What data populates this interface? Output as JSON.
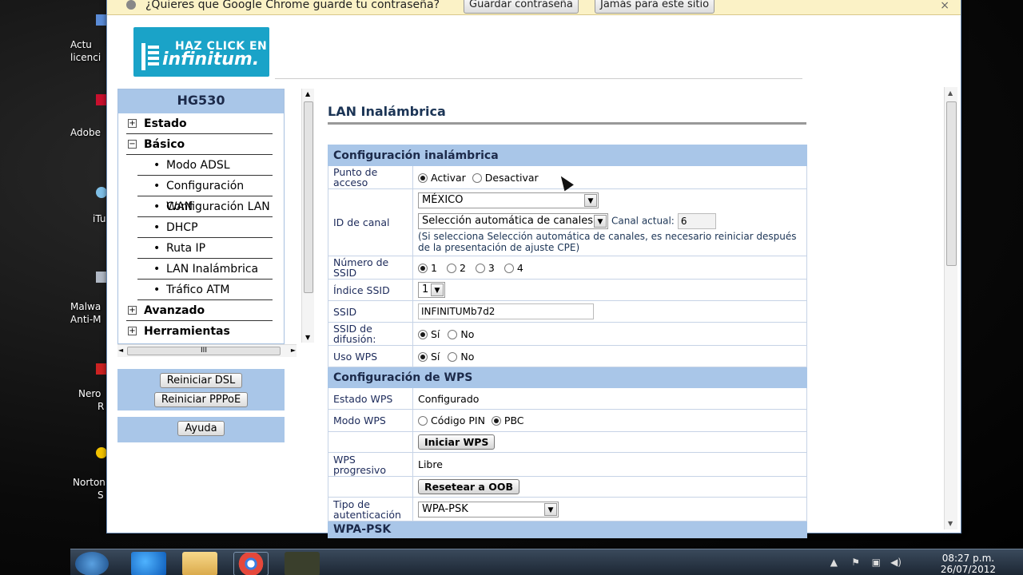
{
  "desktop": {
    "icons": [
      {
        "label_top": "Actu",
        "label_bottom": "licenci",
        "icon": "document-icon"
      },
      {
        "label_top": "Adobe",
        "label_bottom": "",
        "icon": "adobe-icon"
      },
      {
        "label_top": "iTu",
        "label_bottom": "",
        "icon": "itunes-icon"
      },
      {
        "label_top": "Malwa",
        "label_bottom": "Anti-M",
        "icon": "malwarebytes-icon"
      },
      {
        "label_top": "Nero",
        "label_bottom": "R",
        "icon": "nero-icon"
      },
      {
        "label_top": "Norton",
        "label_bottom": "S",
        "icon": "norton-icon"
      }
    ]
  },
  "infobar": {
    "message": "¿Quieres que Google Chrome guarde tu contraseña?",
    "save_label": "Guardar contraseña",
    "never_label": "Jamás para este sitio",
    "close": "×"
  },
  "logo": {
    "line1": "HAZ CLICK EN",
    "line2": "infinitum."
  },
  "nav": {
    "title": "HG530",
    "items": [
      {
        "label": "Estado",
        "box": "+"
      },
      {
        "label": "Básico",
        "box": "−"
      },
      {
        "label": "Modo ADSL"
      },
      {
        "label": "Configuración WAN"
      },
      {
        "label": "Configuración LAN"
      },
      {
        "label": "DHCP"
      },
      {
        "label": "Ruta IP"
      },
      {
        "label": "LAN Inalámbrica"
      },
      {
        "label": "Tráfico ATM"
      },
      {
        "label": "Avanzado",
        "box": "+"
      },
      {
        "label": "Herramientas",
        "box": "+"
      }
    ],
    "hscroll_grip": "III"
  },
  "actions": {
    "reboot_dsl": "Reiniciar DSL",
    "reboot_pppoe": "Reiniciar PPPoE",
    "help": "Ayuda"
  },
  "page": {
    "title": "LAN Inalámbrica",
    "section_wireless": "Configuración inalámbrica",
    "section_wps": "Configuración de WPS",
    "section_wpa": "WPA-PSK",
    "access_point": {
      "label": "Punto de acceso",
      "on": "Activar",
      "off": "Desactivar"
    },
    "channel": {
      "label": "ID de canal",
      "country": "MÉXICO",
      "mode": "Selección automática de canales",
      "current_label": "Canal actual:",
      "current_value": "6",
      "note": "(Si selecciona Selección automática de canales, es necesario reiniciar después de la presentación de ajuste CPE)"
    },
    "ssid_count": {
      "label": "Número de SSID",
      "options": [
        "1",
        "2",
        "3",
        "4"
      ]
    },
    "ssid_index": {
      "label": "Índice SSID",
      "value": "1"
    },
    "ssid": {
      "label": "SSID",
      "value": "INFINITUMb7d2"
    },
    "broadcast": {
      "label": "SSID de difusión:",
      "yes": "Sí",
      "no": "No"
    },
    "use_wps": {
      "label": "Uso WPS",
      "yes": "Sí",
      "no": "No"
    },
    "wps_state": {
      "label": "Estado WPS",
      "value": "Configurado"
    },
    "wps_mode": {
      "label": "Modo WPS",
      "pin": "Código PIN",
      "pbc": "PBC"
    },
    "start_wps": "Iniciar WPS",
    "wps_progress": {
      "label": "WPS progresivo",
      "value": "Libre"
    },
    "reset_oob": "Resetear a OOB",
    "auth_type": {
      "label": "Tipo de autenticación",
      "value": "WPA-PSK"
    }
  },
  "taskbar": {
    "time": "08:27 p.m.",
    "date": "26/07/2012"
  },
  "colors": {
    "section_bg": "#a9c6e8",
    "title_text": "#1c3556",
    "logo_bg": "#1aa3c8"
  }
}
